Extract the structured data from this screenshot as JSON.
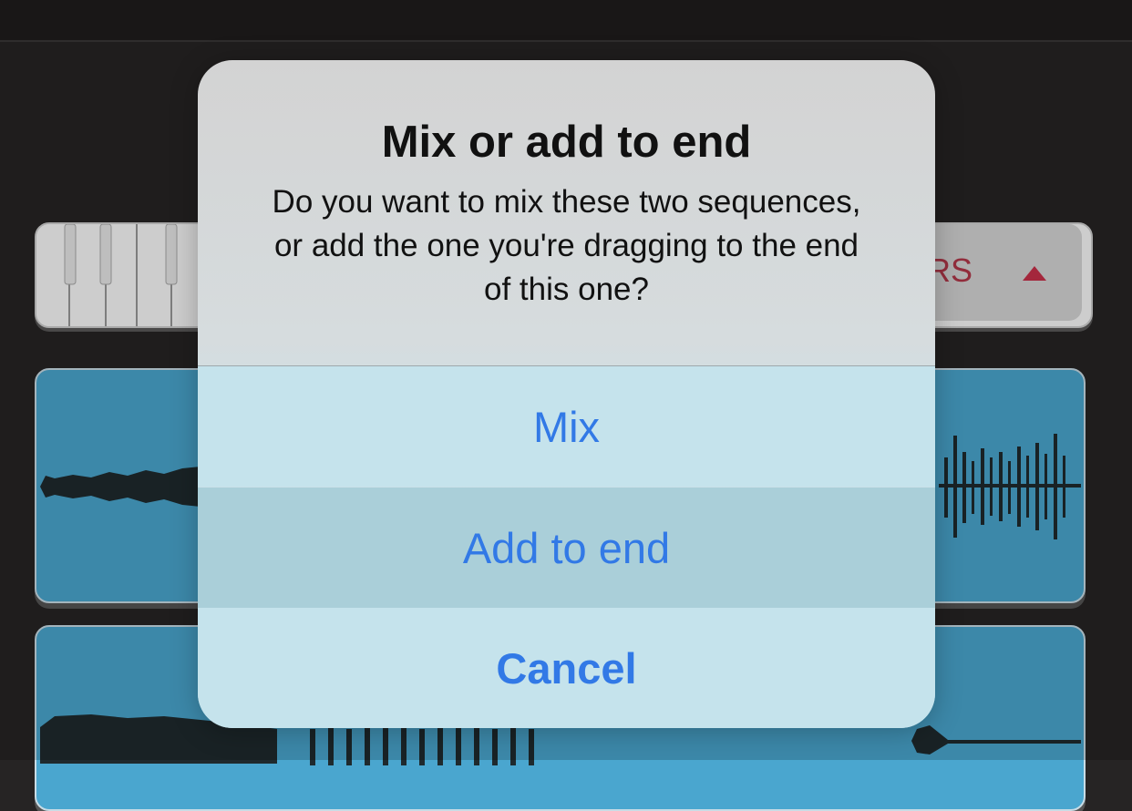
{
  "background": {
    "fx_label": "RS",
    "expand_icon": "triangle-up-icon",
    "accent_red": "#b2384a",
    "track_color": "#4aa6cf"
  },
  "alert": {
    "title": "Mix or add to end",
    "message": "Do you want to mix these two sequences, or add the one you're dragging to the end of this one?",
    "buttons": {
      "mix": "Mix",
      "add_to_end": "Add to end",
      "cancel": "Cancel"
    },
    "button_color": "#3279e6"
  }
}
